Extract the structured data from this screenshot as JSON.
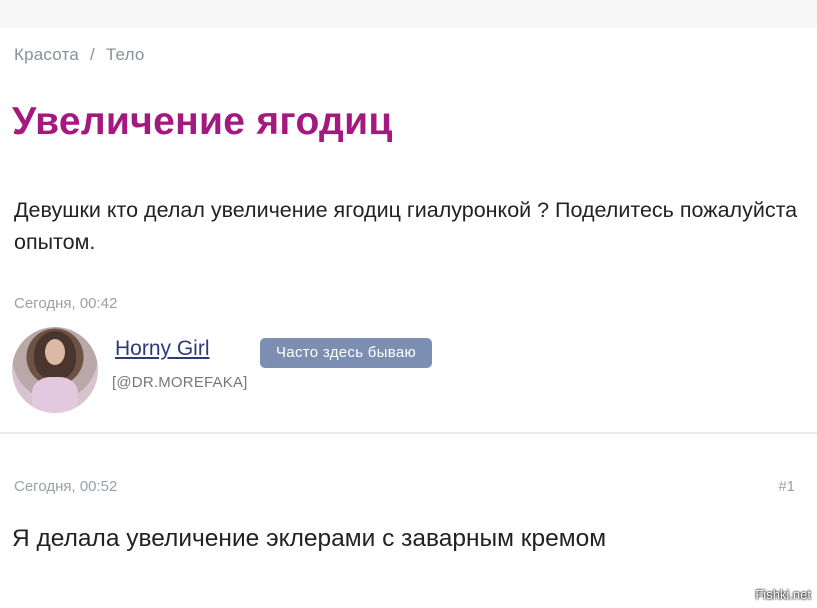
{
  "breadcrumb": {
    "category": "Красота",
    "separator": "/",
    "subcategory": "Тело"
  },
  "question": {
    "title": "Увеличение ягодиц",
    "text": "Девушки кто делал увеличение ягодиц гиалуронкой ? Поделитесь пожалуйста опытом.",
    "date": "Сегодня, 00:42"
  },
  "author": {
    "username": "Horny Girl",
    "badge": "Часто здесь бываю",
    "handle": "[@DR.MOREFAKA]"
  },
  "answer": {
    "date": "Сегодня, 00:52",
    "post_number": "#1",
    "text": "Я делала увеличение эклерами с заварным кремом"
  },
  "watermark": "Fishki.net",
  "colors": {
    "title": "#a3197f",
    "badge": "#7c8fb2",
    "username": "#2f3a78"
  }
}
